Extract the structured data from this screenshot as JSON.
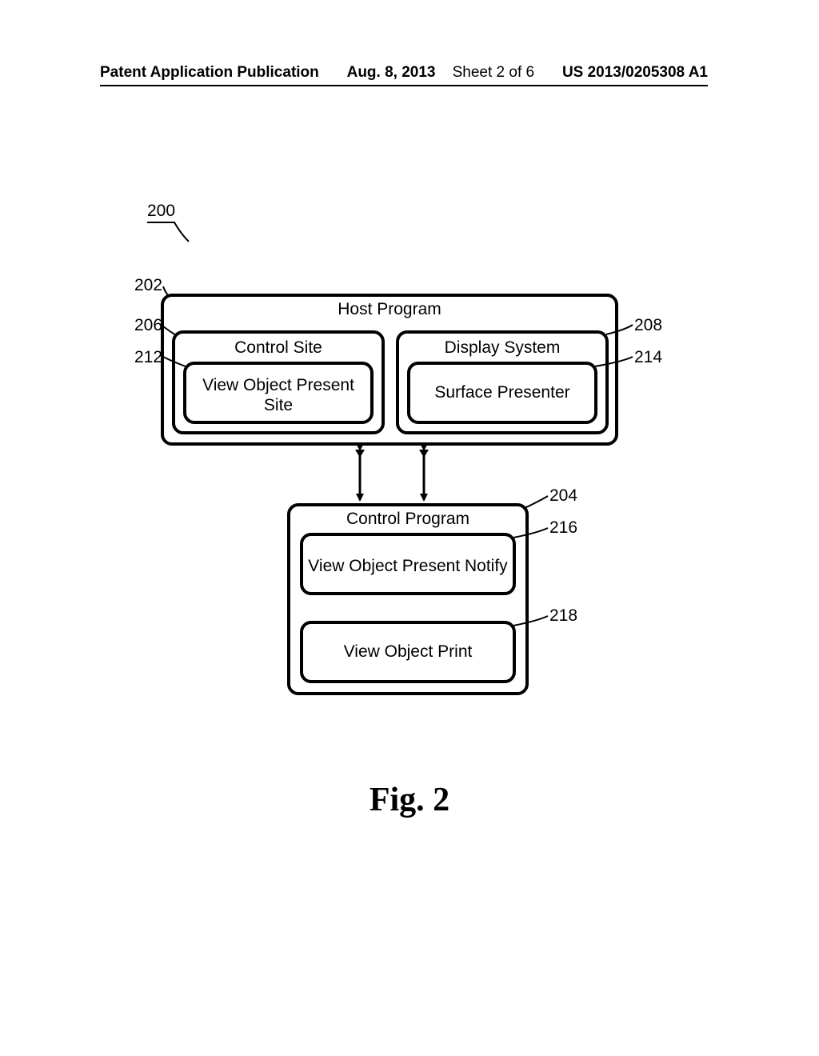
{
  "header": {
    "publication_label": "Patent Application Publication",
    "date": "Aug. 8, 2013",
    "sheet": "Sheet 2 of 6",
    "pub_number": "US 2013/0205308 A1"
  },
  "figure": {
    "overall_ref": "200",
    "caption": "Fig. 2",
    "host_program": {
      "ref": "202",
      "label": "Host Program",
      "control_site": {
        "ref": "206",
        "label": "Control Site",
        "view_object_present_site": {
          "ref": "212",
          "label": "View Object Present Site"
        }
      },
      "display_system": {
        "ref": "208",
        "label": "Display System",
        "surface_presenter": {
          "ref": "214",
          "label": "Surface Presenter"
        }
      }
    },
    "control_program": {
      "ref": "204",
      "label": "Control Program",
      "view_object_present_notify": {
        "ref": "216",
        "label": "View Object Present Notify"
      },
      "view_object_print": {
        "ref": "218",
        "label": "View Object Print"
      }
    }
  }
}
